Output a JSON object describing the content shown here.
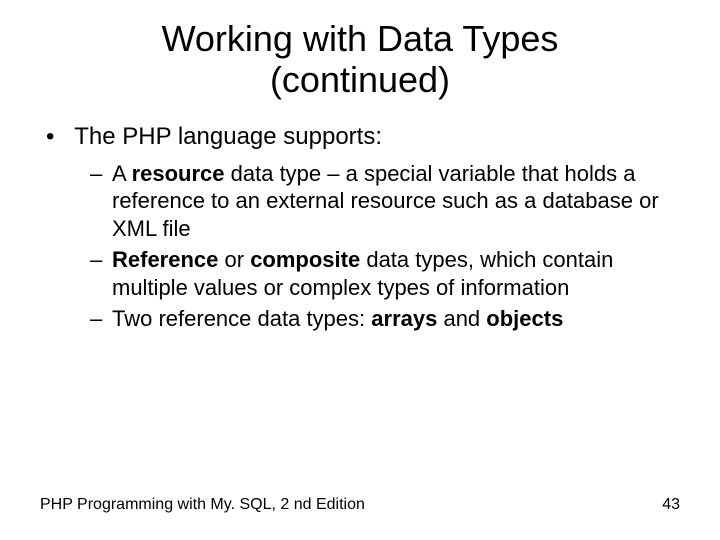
{
  "title_line1": "Working with Data Types",
  "title_line2": "(continued)",
  "bullet1": "The PHP language supports:",
  "sub1_pre": "A ",
  "sub1_b1": "resource",
  "sub1_post": " data type – a special variable that holds a reference to an external resource such as a database or XML file",
  "sub2_b1": "Reference",
  "sub2_mid": " or ",
  "sub2_b2": "composite",
  "sub2_post": " data types, which contain multiple values or complex types of information",
  "sub3_pre": "Two reference data types: ",
  "sub3_b1": "arrays",
  "sub3_mid": " and ",
  "sub3_b2": "objects",
  "footer_left": "PHP Programming with My. SQL, 2 nd Edition",
  "footer_right": "43"
}
